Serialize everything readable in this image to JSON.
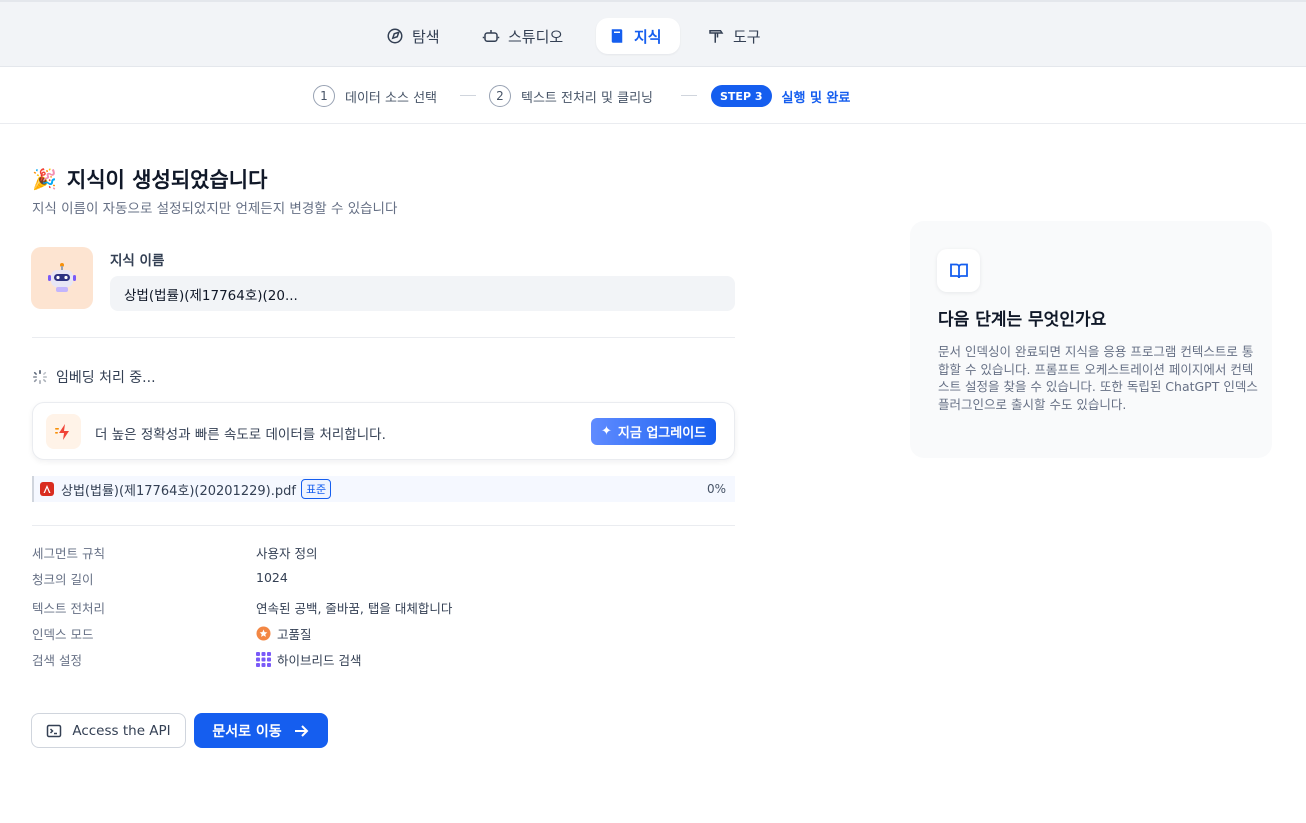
{
  "nav": {
    "tabs": [
      {
        "label": "탐색",
        "icon": "compass-icon"
      },
      {
        "label": "스튜디오",
        "icon": "robot-icon"
      },
      {
        "label": "지식",
        "icon": "book-icon",
        "active": true
      },
      {
        "label": "도구",
        "icon": "hammer-icon"
      }
    ]
  },
  "stepper": {
    "steps": [
      {
        "num": "1",
        "label": "데이터 소스 선택"
      },
      {
        "num": "2",
        "label": "텍스트 전처리 및 클리닝"
      },
      {
        "num": "STEP 3",
        "label": "실행 및 완료",
        "active": true
      }
    ]
  },
  "main": {
    "emoji": "🎉",
    "title": "지식이 생성되었습니다",
    "subtitle": "지식 이름이 자동으로 설정되었지만 언제든지 변경할 수 있습니다",
    "name_label": "지식 이름",
    "name_value": "상법(법률)(제17764호)(20...",
    "embedding_status": "임베딩 처리 중...",
    "upgrade": {
      "text": "더 높은 정확성과 빠른 속도로 데이터를 처리합니다.",
      "button": "지금 업그레이드"
    },
    "file": {
      "name": "상법(법률)(제17764호)(20201229).pdf",
      "badge": "표준",
      "progress": "0%"
    },
    "info": [
      {
        "label": "세그먼트 규칙",
        "value": "사용자 정의"
      },
      {
        "label": "청크의 길이",
        "value": "1024"
      },
      {
        "label": "텍스트 전처리",
        "value": "연속된 공백, 줄바꿈, 탭을 대체합니다"
      },
      {
        "label": "인덱스 모드",
        "value": "고품질",
        "icon": "quality-icon"
      },
      {
        "label": "검색 설정",
        "value": "하이브리드 검색",
        "icon": "grid-icon"
      }
    ],
    "buttons": {
      "api": "Access the API",
      "docs": "문서로 이동"
    }
  },
  "side": {
    "title": "다음 단계는 무엇인가요",
    "description": "문서 인덱싱이 완료되면 지식을 응용 프로그램 컨텍스트로 통합할 수 있습니다. 프롬프트 오케스트레이션 페이지에서 컨텍스트 설정을 찾을 수 있습니다. 또한 독립된 ChatGPT 인덱스 플러그인으로 출시할 수도 있습니다."
  },
  "colors": {
    "accent": "#155eef",
    "avatar_bg": "#fde4d1",
    "pdf_red": "#d92d20"
  }
}
